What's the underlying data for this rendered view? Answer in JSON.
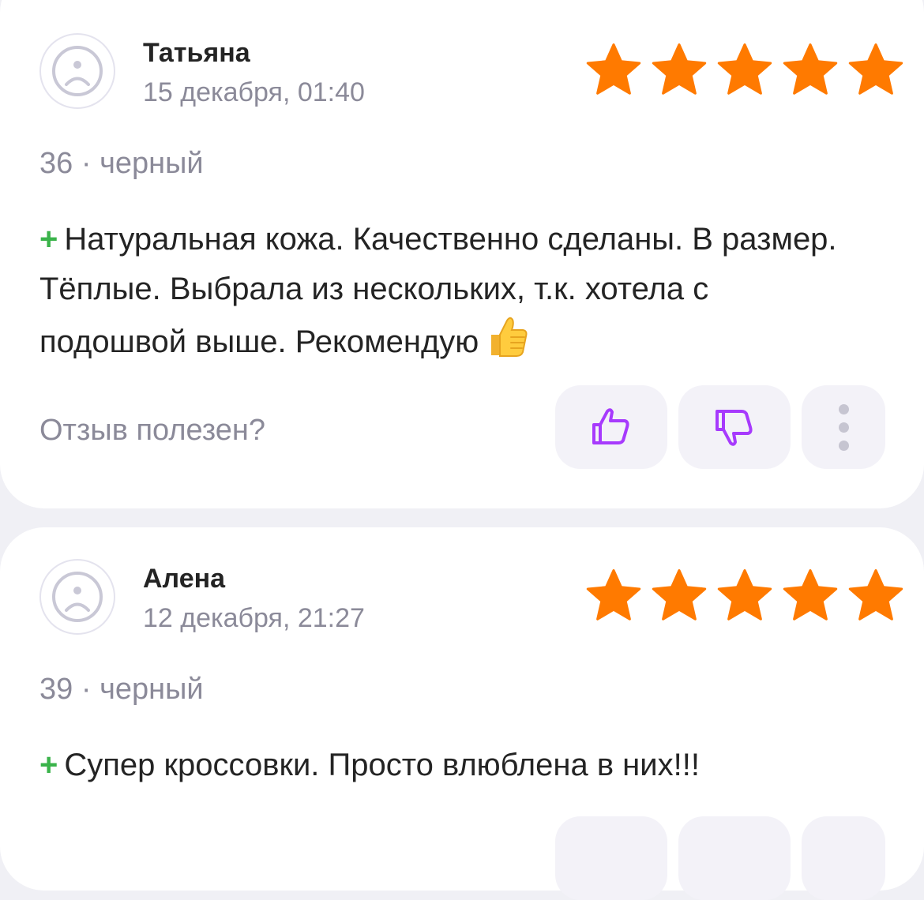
{
  "reviews": [
    {
      "author": "Татьяна",
      "date": "15 декабря, 01:40",
      "rating": 5,
      "size": "36",
      "separator": " · ",
      "color": "черный",
      "plus_sign": "+",
      "text": "Натуральная кожа. Качественно сделаны. В размер. Тёплые. Выбрала из нескольких, т.к. хотела с подошвой выше. Рекомендую",
      "emoji_icon": "thumbs-up-emoji",
      "helpful_question": "Отзыв полезен?"
    },
    {
      "author": "Алена",
      "date": "12 декабря, 21:27",
      "rating": 5,
      "size": "39",
      "separator": " · ",
      "color": "черный",
      "plus_sign": "+",
      "text": "Супер кроссовки. Просто влюблена в них!!!"
    }
  ],
  "colors": {
    "star": "#ff7a00",
    "plus": "#3ab34a",
    "vote_icon": "#a73afd",
    "secondary_text": "#8b8a99"
  },
  "icons": {
    "avatar": "avatar-placeholder-icon",
    "like": "thumbs-up-icon",
    "dislike": "thumbs-down-icon",
    "more": "more-vertical-icon",
    "star": "star-icon"
  }
}
